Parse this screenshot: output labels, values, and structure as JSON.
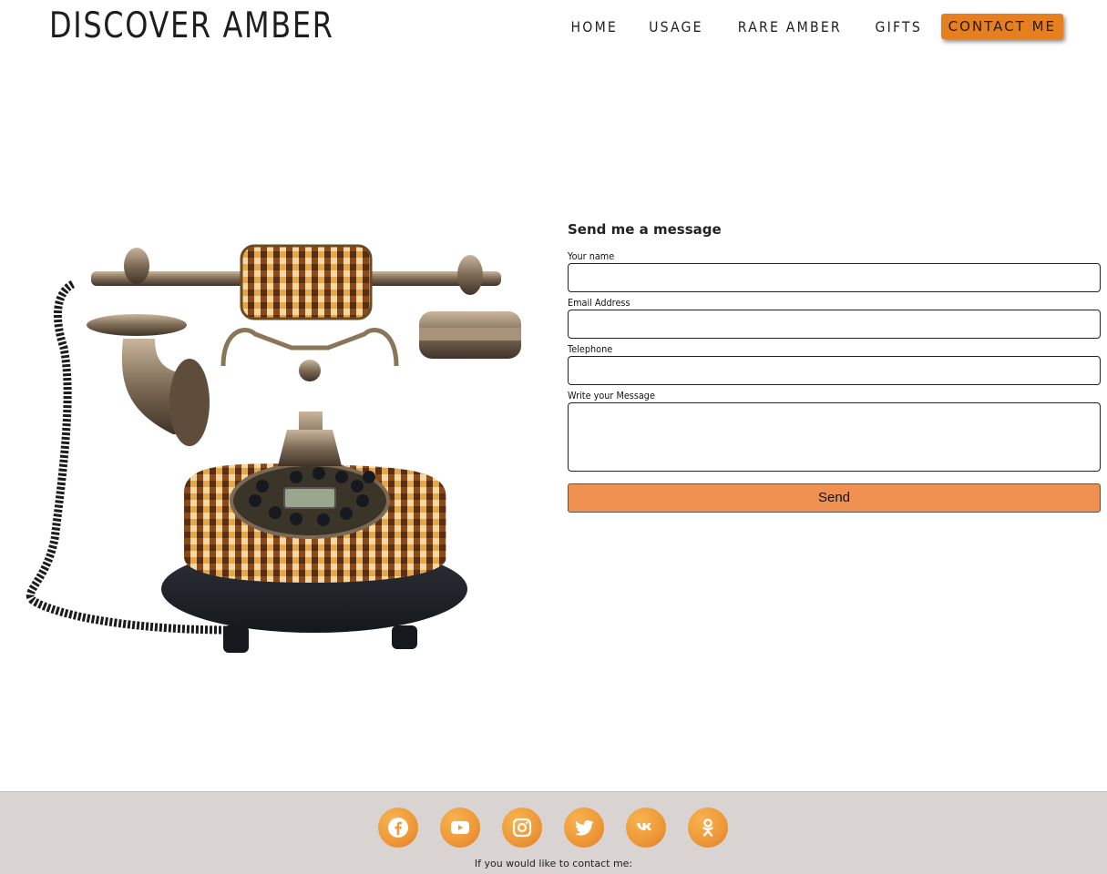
{
  "header": {
    "brand": "DISCOVER AMBER",
    "nav": [
      {
        "label": "HOME"
      },
      {
        "label": "USAGE"
      },
      {
        "label": "RARE AMBER"
      },
      {
        "label": "GIFTS"
      },
      {
        "label": "CONTACT ME",
        "active": true
      }
    ]
  },
  "hero_image": {
    "description_icon": "amber-telephone-image"
  },
  "form": {
    "title": "Send me a message",
    "name_label": "Your name",
    "email_label": "Email Address",
    "phone_label": "Telephone",
    "message_label": "Write your Message",
    "send_label": "Send"
  },
  "footer": {
    "socials": [
      {
        "icon": "facebook-icon"
      },
      {
        "icon": "youtube-icon"
      },
      {
        "icon": "instagram-icon"
      },
      {
        "icon": "twitter-icon"
      },
      {
        "icon": "vk-icon"
      },
      {
        "icon": "odnoklassniki-icon"
      }
    ],
    "text": "If you would like to contact me:"
  },
  "colors": {
    "accent": "#e57f1f",
    "send_button": "#ef9150",
    "footer_bg": "#d9d4d1"
  }
}
